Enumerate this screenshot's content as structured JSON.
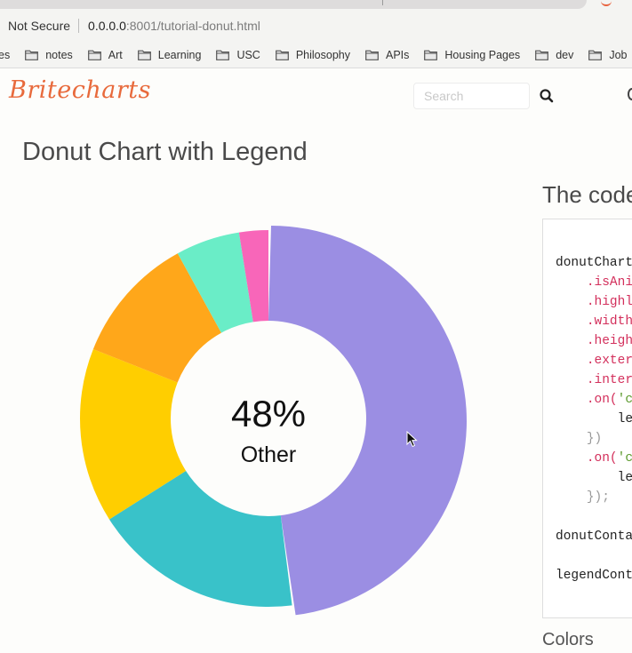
{
  "browser": {
    "security_label": "Not Secure",
    "url_host": "0.0.0.0",
    "url_rest": ":8001/tutorial-donut.html",
    "bookmarks": [
      {
        "label": "es"
      },
      {
        "label": "notes"
      },
      {
        "label": "Art"
      },
      {
        "label": "Learning"
      },
      {
        "label": "USC"
      },
      {
        "label": "Philosophy"
      },
      {
        "label": "APIs"
      },
      {
        "label": "Housing Pages"
      },
      {
        "label": "dev"
      },
      {
        "label": "Job"
      }
    ]
  },
  "site": {
    "logo_text": "Britecharts",
    "search_placeholder": "Search"
  },
  "main": {
    "title": "Donut Chart with Legend"
  },
  "code_panel": {
    "title": "The code",
    "lines": [
      [
        {
          "t": "donutChart",
          "c": ""
        }
      ],
      [
        {
          "t": "    ",
          "c": ""
        },
        {
          "t": ".isAni",
          "c": "m"
        }
      ],
      [
        {
          "t": "    ",
          "c": ""
        },
        {
          "t": ".highl",
          "c": "m"
        }
      ],
      [
        {
          "t": "    ",
          "c": ""
        },
        {
          "t": ".width",
          "c": "m"
        }
      ],
      [
        {
          "t": "    ",
          "c": ""
        },
        {
          "t": ".heigh",
          "c": "m"
        }
      ],
      [
        {
          "t": "    ",
          "c": ""
        },
        {
          "t": ".exter",
          "c": "m"
        }
      ],
      [
        {
          "t": "    ",
          "c": ""
        },
        {
          "t": ".inter",
          "c": "m"
        }
      ],
      [
        {
          "t": "    ",
          "c": ""
        },
        {
          "t": ".on(",
          "c": "m"
        },
        {
          "t": "'c",
          "c": "s"
        }
      ],
      [
        {
          "t": "        le",
          "c": ""
        }
      ],
      [
        {
          "t": "    ",
          "c": ""
        },
        {
          "t": "})",
          "c": "p"
        }
      ],
      [
        {
          "t": "    ",
          "c": ""
        },
        {
          "t": ".on(",
          "c": "m"
        },
        {
          "t": "'c",
          "c": "s"
        }
      ],
      [
        {
          "t": "        le",
          "c": ""
        }
      ],
      [
        {
          "t": "    ",
          "c": ""
        },
        {
          "t": "});",
          "c": "p"
        }
      ],
      [
        {
          "t": "",
          "c": ""
        }
      ],
      [
        {
          "t": "donutConta",
          "c": ""
        }
      ],
      [
        {
          "t": "",
          "c": ""
        }
      ],
      [
        {
          "t": "legendCont",
          "c": ""
        }
      ]
    ]
  },
  "colors_section": {
    "title": "Colors"
  },
  "chart_data": {
    "type": "pie",
    "variant": "donut",
    "center_value": "48%",
    "center_label": "Other",
    "highlighted_slice": "Other",
    "slices": [
      {
        "name": "Other",
        "value": 48,
        "color": "#9b8ee3"
      },
      {
        "name": "",
        "value": 18,
        "color": "#39c2c9"
      },
      {
        "name": "",
        "value": 15,
        "color": "#ffce00"
      },
      {
        "name": "",
        "value": 11,
        "color": "#ffa71a"
      },
      {
        "name": "",
        "value": 5.5,
        "color": "#6aedc7"
      },
      {
        "name": "",
        "value": 2.5,
        "color": "#f866b9"
      }
    ]
  }
}
